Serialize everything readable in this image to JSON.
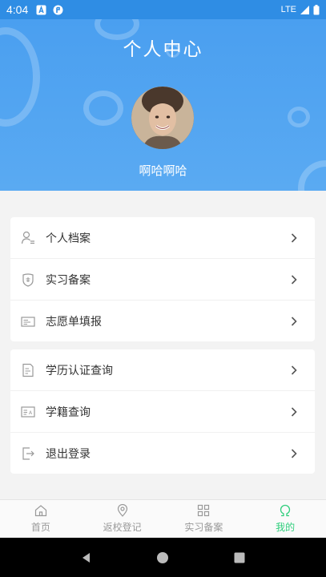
{
  "status_bar": {
    "time": "4:04",
    "network": "LTE"
  },
  "header": {
    "title": "个人中心",
    "username": "啊哈啊哈"
  },
  "menu_group_1": [
    {
      "label": "个人档案",
      "icon": "person-doc-icon"
    },
    {
      "label": "实习备案",
      "icon": "shield-badge-icon"
    },
    {
      "label": "志愿单填报",
      "icon": "form-card-icon"
    }
  ],
  "menu_group_2": [
    {
      "label": "学历认证查询",
      "icon": "certificate-icon"
    },
    {
      "label": "学籍查询",
      "icon": "id-card-icon"
    },
    {
      "label": "退出登录",
      "icon": "logout-icon"
    }
  ],
  "bottom_nav": [
    {
      "label": "首页",
      "icon": "home-icon",
      "active": false
    },
    {
      "label": "返校登记",
      "icon": "location-icon",
      "active": false
    },
    {
      "label": "实习备案",
      "icon": "grid-icon",
      "active": false
    },
    {
      "label": "我的",
      "icon": "profile-icon",
      "active": true
    }
  ],
  "colors": {
    "header": "#4a9ff0",
    "status_bar": "#2f8de4",
    "active_tab": "#2fce7c"
  }
}
